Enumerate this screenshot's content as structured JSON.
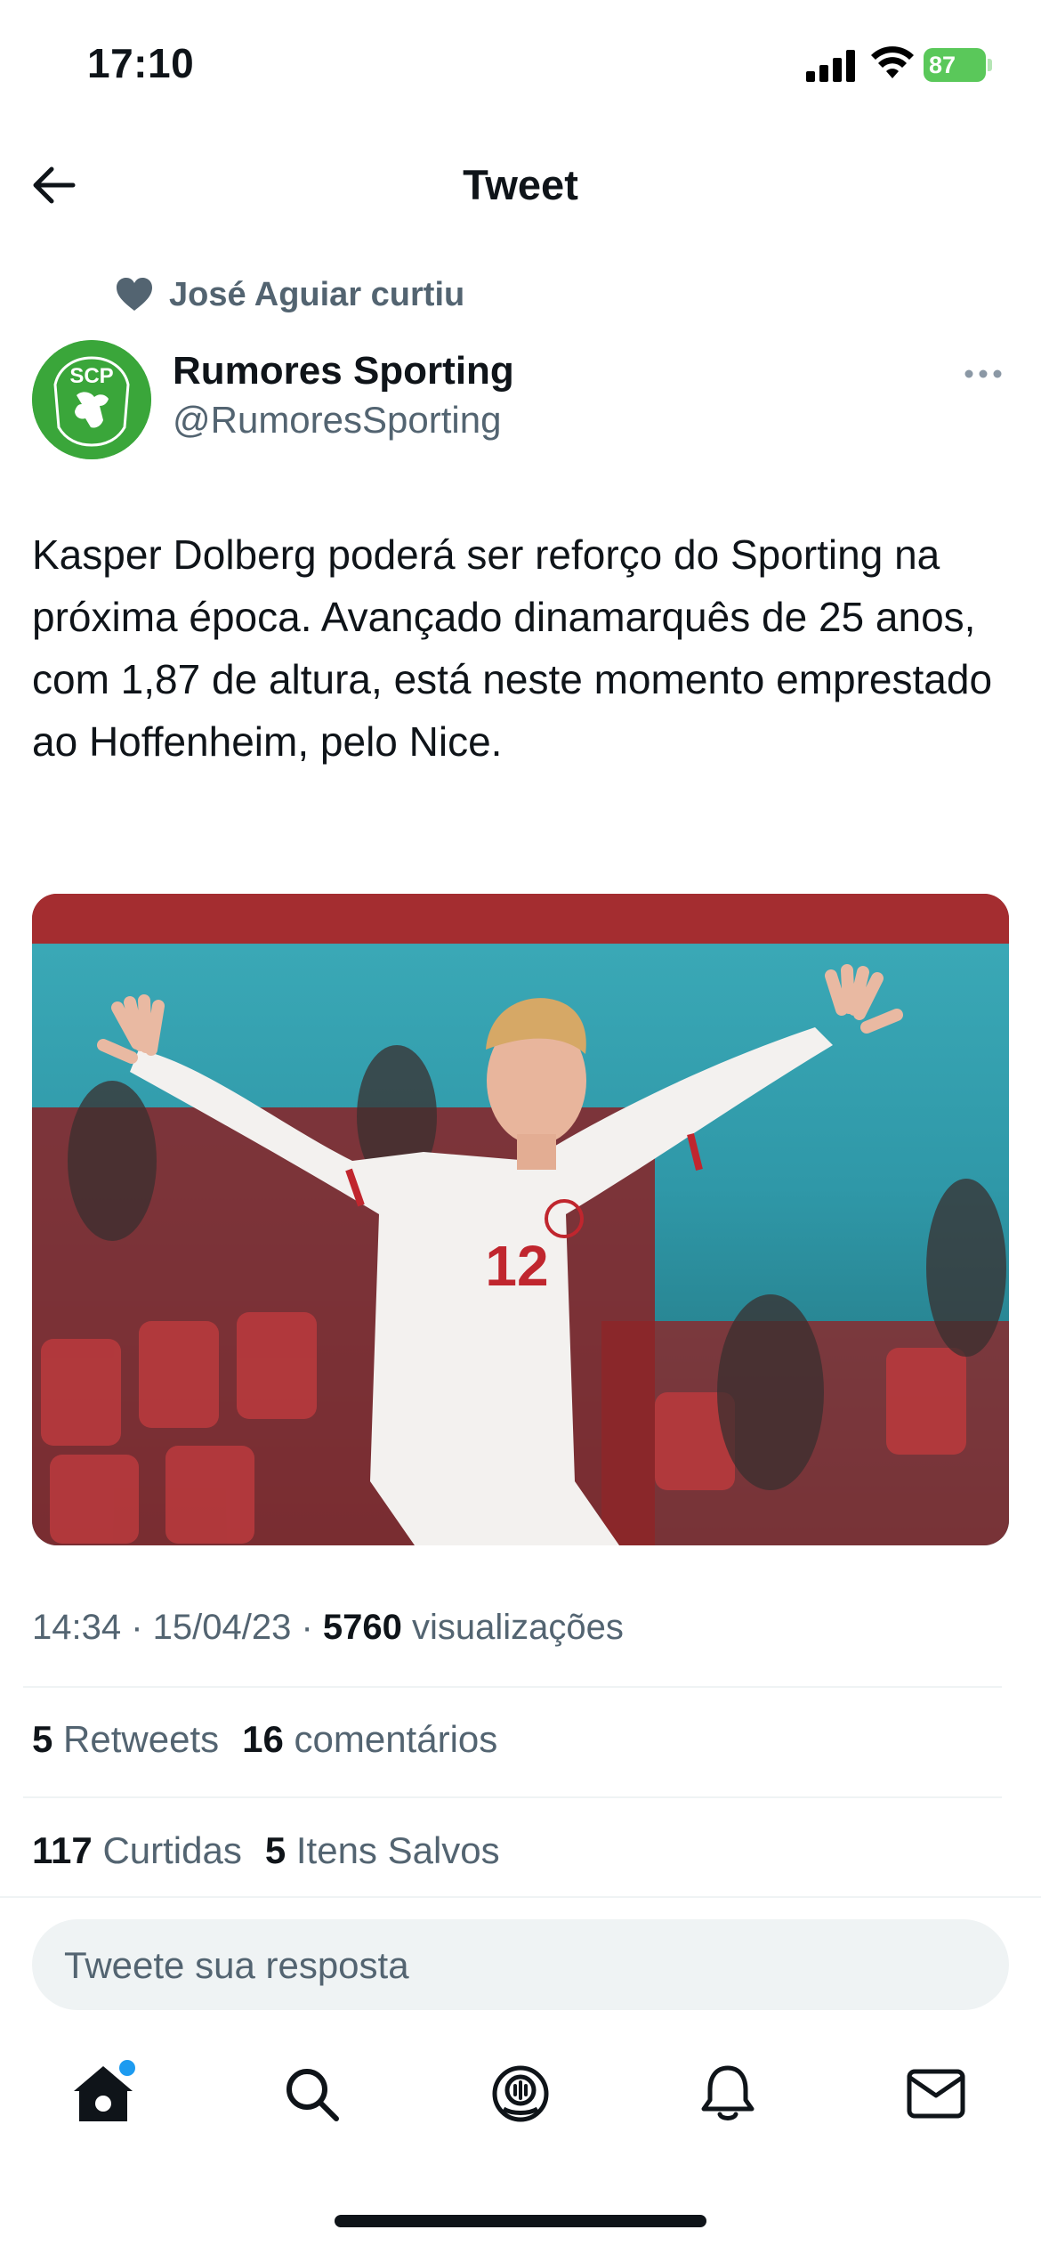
{
  "status_bar": {
    "time": "17:10",
    "battery": "87"
  },
  "header": {
    "title": "Tweet"
  },
  "social_context": {
    "text": "José Aguiar curtiu"
  },
  "author": {
    "name": "Rumores Sporting",
    "handle": "@RumoresSporting",
    "avatar_text": "SCP"
  },
  "tweet": {
    "text": "Kasper Dolberg poderá ser reforço do Sporting na próxima época. Avançado dinamarquês de 25 anos, com 1,87 de altura, está neste momento emprestado ao Hoffenheim, pelo Nice.",
    "jersey_number": "12",
    "time": "14:34",
    "date": "15/04/23",
    "views_count": "5760",
    "views_label": "visualizações"
  },
  "stats": {
    "retweets_count": "5",
    "retweets_label": "Retweets",
    "comments_count": "16",
    "comments_label": "comentários",
    "likes_count": "117",
    "likes_label": "Curtidas",
    "saved_count": "5",
    "saved_label": "Itens Salvos"
  },
  "reply": {
    "placeholder": "Tweete sua resposta"
  },
  "tabbar": {
    "items": [
      "home-icon",
      "search-icon",
      "spaces-icon",
      "notifications-icon",
      "messages-icon"
    ]
  },
  "colors": {
    "text_primary": "#0f1419",
    "text_secondary": "#536471",
    "accent": "#1d9bf0",
    "avatar_green": "#3aa63a",
    "battery_green": "#5ac85a"
  }
}
